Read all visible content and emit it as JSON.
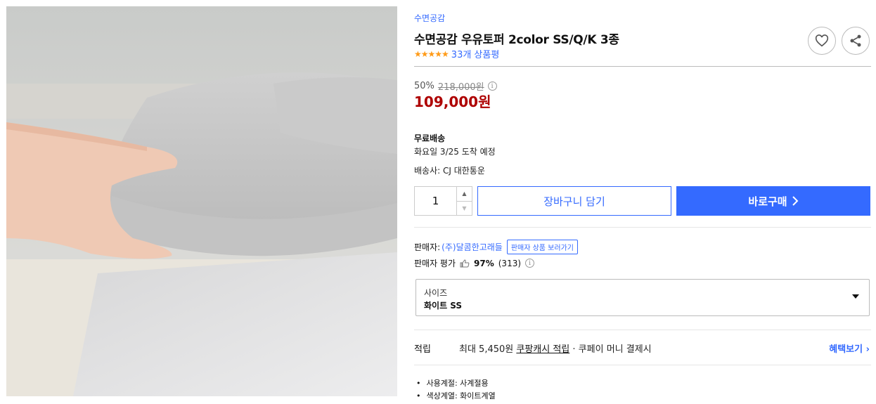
{
  "product": {
    "image_alt": "hand lifting thick gray mattress topper on bed",
    "brand": "수면공감",
    "title": "수면공감 우유토퍼 2color SS/Q/K 3종",
    "stars": "★★★★★",
    "review_count": "33개 상품평",
    "rating_value": 5
  },
  "icons": {
    "wishlist": "heart-icon",
    "share": "share-icon",
    "info": "info-icon",
    "thumb": "thumbs-up-icon",
    "caret": "chevron-down-icon"
  },
  "price": {
    "discount": "50%",
    "original": "218,000원",
    "sale": "109,000원"
  },
  "shipping": {
    "label": "무료배송",
    "arrival": "화요일 3/25 도착 예정",
    "courier": "배송사: CJ 대한통운"
  },
  "purchase": {
    "quantity": "1",
    "cart_label": "장바구니 담기",
    "buy_label": "바로구매"
  },
  "seller": {
    "label": "판매자:",
    "name": "(주)달콤한고래들",
    "link": "판매자 상품 보러가기",
    "rating_label": "판매자 평가",
    "rating_pct": "97%",
    "rating_count": "(313)"
  },
  "option": {
    "label": "사이즈",
    "value": "화이트 SS"
  },
  "reward": {
    "label": "적립",
    "prefix": "최대 5,450원",
    "link": "쿠팡캐시 적립",
    "suffix": "· 쿠페이 머니 결제시",
    "benefit": "혜택보기 ›"
  },
  "attributes": [
    "사용계절: 사계절용",
    "색상계열: 화이트계열"
  ],
  "colors": {
    "accent": "#346aff",
    "price": "#ae0000",
    "star": "#ff9b18"
  }
}
